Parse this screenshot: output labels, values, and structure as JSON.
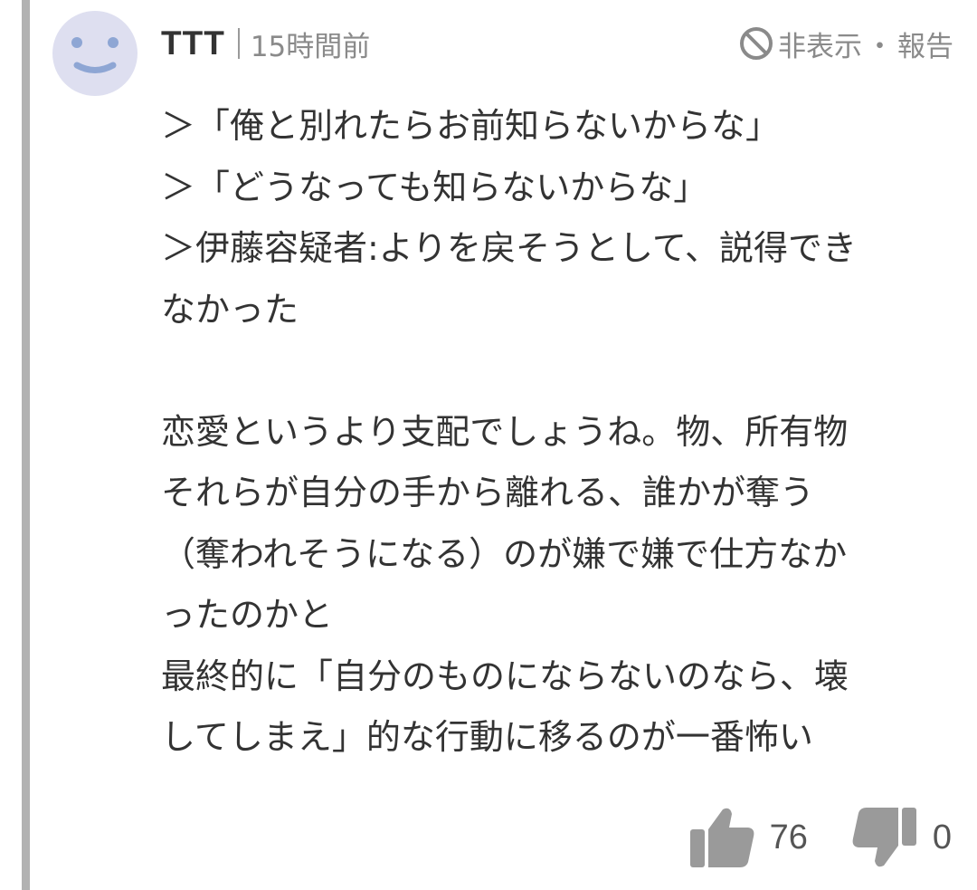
{
  "comment": {
    "username": "TTT",
    "timestamp": "15時間前",
    "hide_label": "非表示",
    "dot": "・",
    "report_label": "報告",
    "body_lines": [
      "＞「俺と別れたらお前知らないからな」",
      "＞「どうなっても知らないからな」",
      "＞伊藤容疑者:よりを戻そうとして、説得でき",
      "なかった",
      "",
      "恋愛というより支配でしょうね。物、所有物",
      "それらが自分の手から離れる、誰かが奪う",
      "（奪われそうになる）のが嫌で嫌で仕方なか",
      "ったのかと",
      "最終的に「自分のものにならないのなら、壊",
      "してしまえ」的な行動に移るのが一番怖い"
    ],
    "likes": "76",
    "dislikes": "0"
  },
  "icons": {
    "avatar": "smiley-face-icon",
    "hide": "prohibited-icon",
    "like": "thumbs-up-icon",
    "dislike": "thumbs-down-icon"
  },
  "colors": {
    "avatar_bg": "#dedff0",
    "avatar_face": "#8ea6d4",
    "icon_gray": "#9a9a9a",
    "text": "#333333",
    "muted": "#8a8a8a",
    "left_rule": "#b2b2b2"
  }
}
